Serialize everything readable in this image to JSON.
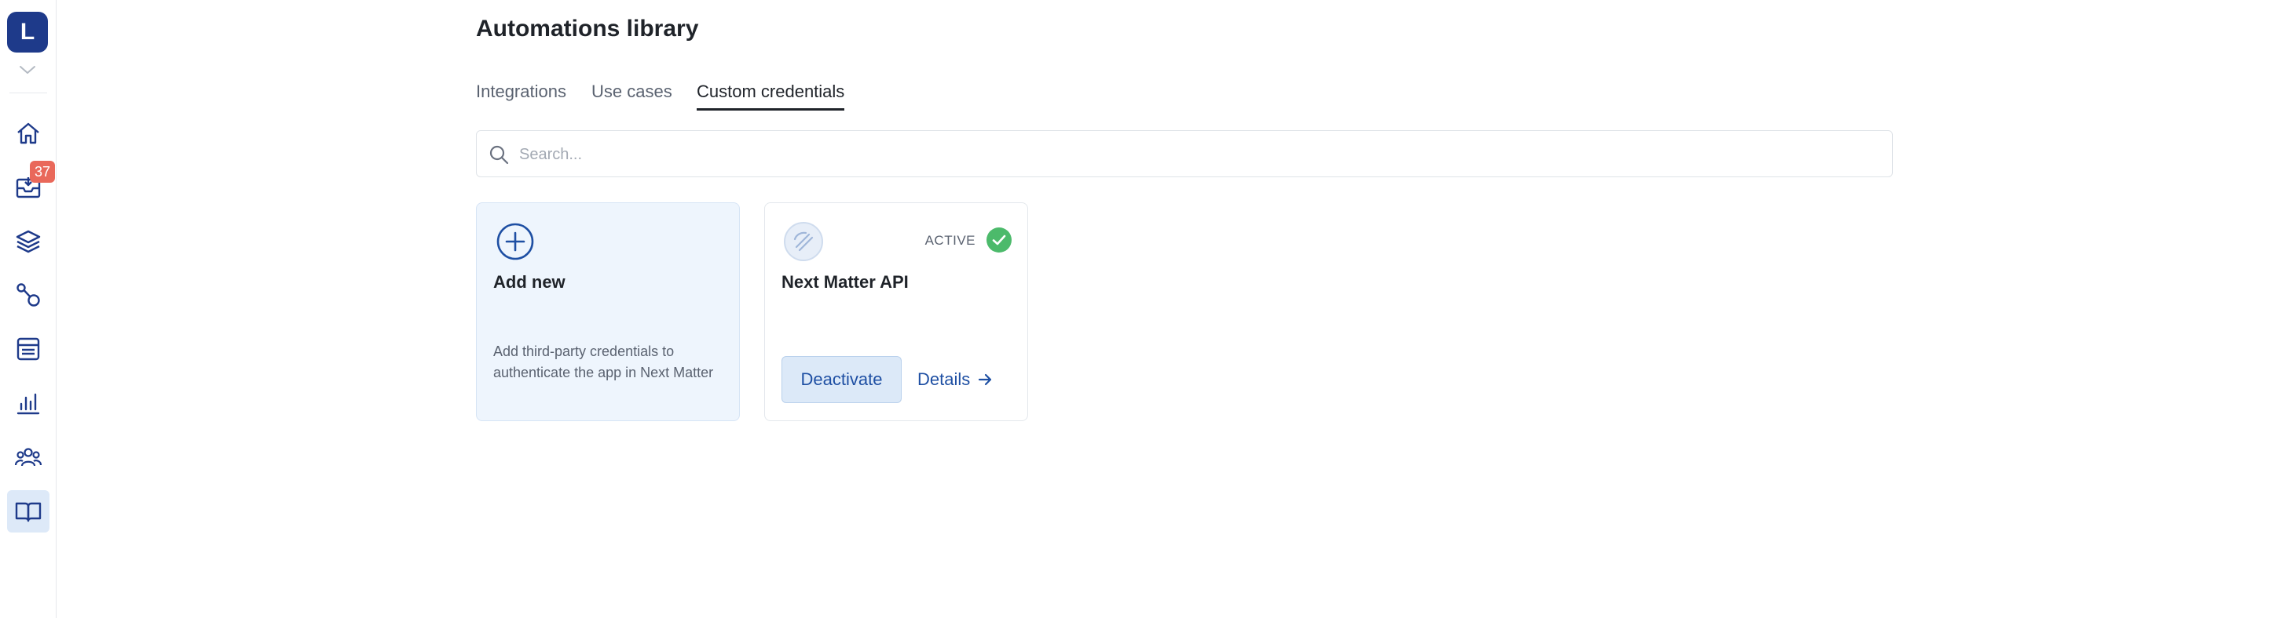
{
  "sidebar": {
    "logo_letter": "L",
    "inbox_badge": "37",
    "items": [
      {
        "name": "home-icon"
      },
      {
        "name": "inbox-icon"
      },
      {
        "name": "layers-icon"
      },
      {
        "name": "workflow-icon"
      },
      {
        "name": "list-icon"
      },
      {
        "name": "chart-icon"
      },
      {
        "name": "team-icon"
      },
      {
        "name": "book-icon",
        "active": true
      }
    ]
  },
  "header": {
    "title": "Automations library"
  },
  "tabs": [
    {
      "label": "Integrations"
    },
    {
      "label": "Use cases"
    },
    {
      "label": "Custom credentials",
      "active": true
    }
  ],
  "search": {
    "placeholder": "Search...",
    "value": ""
  },
  "cards": {
    "add_new": {
      "title": "Add new",
      "description": "Add third-party credentials to authenticate the app in Next Matter"
    },
    "credential": {
      "title": "Next Matter API",
      "status": "ACTIVE",
      "deactivate_label": "Deactivate",
      "details_label": "Details"
    }
  },
  "colors": {
    "brand": "#1e3a8a",
    "accent": "#1e4fa3",
    "badge": "#e9685a",
    "active_status": "#4cba6b",
    "active_nav_bg": "#dde9f8"
  }
}
